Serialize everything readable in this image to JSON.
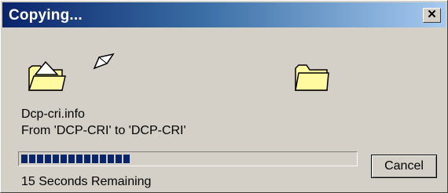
{
  "window": {
    "title": "Copying..."
  },
  "titlebar": {
    "close_glyph": "✕"
  },
  "animation": {
    "source_icon": "open-folder-icon",
    "flying_icon": "flying-paper-icon",
    "dest_icon": "folder-icon"
  },
  "file": {
    "name": "Dcp-cri.info",
    "route": "From 'DCP-CRI' to 'DCP-CRI'"
  },
  "progress": {
    "fraction": 0.33,
    "remaining": "15 Seconds Remaining"
  },
  "buttons": {
    "cancel": "Cancel"
  },
  "colors": {
    "title_start": "#0a246a",
    "title_end": "#a6caf0",
    "progress": "#0a246a",
    "face": "#d4d0c8",
    "folder": "#fff9a0"
  }
}
